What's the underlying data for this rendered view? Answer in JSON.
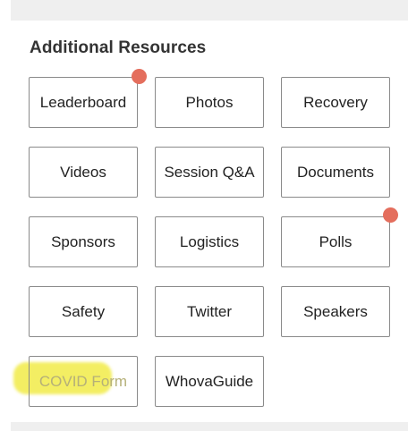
{
  "section": {
    "title": "Additional Resources"
  },
  "tiles": [
    {
      "label": "Leaderboard"
    },
    {
      "label": "Photos"
    },
    {
      "label": "Recovery"
    },
    {
      "label": "Videos"
    },
    {
      "label": "Session Q&A"
    },
    {
      "label": "Documents"
    },
    {
      "label": "Sponsors"
    },
    {
      "label": "Logistics"
    },
    {
      "label": "Polls"
    },
    {
      "label": "Safety"
    },
    {
      "label": "Twitter"
    },
    {
      "label": "Speakers"
    },
    {
      "label": "COVID Form"
    },
    {
      "label": "WhovaGuide"
    }
  ],
  "colors": {
    "notification_badge": "#e46e5d",
    "highlight": "#f2ec4e",
    "tile_border": "#8a8a8a"
  },
  "icons": {
    "notification": "notification-dot-icon"
  }
}
